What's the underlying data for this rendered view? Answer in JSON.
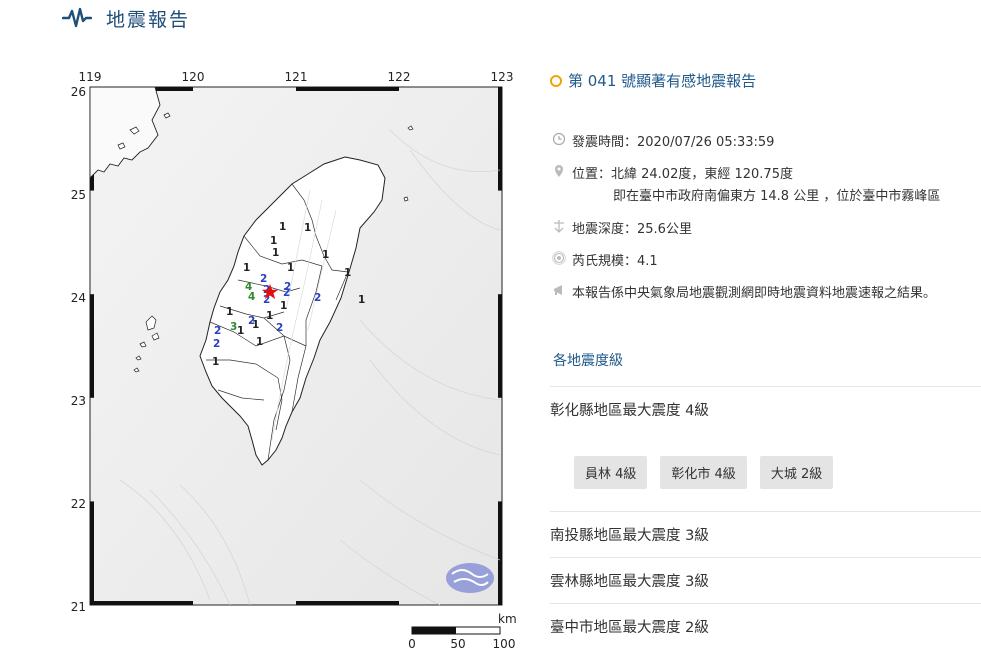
{
  "header": {
    "title": "地震報告",
    "icon": "seismograph-icon"
  },
  "report": {
    "title": "第 041 號顯著有感地震報告",
    "time_label": "發震時間：2020/07/26 05:33:59",
    "location_label": "位置：北緯 24.02度，東經 120.75度",
    "location_detail": "即在臺中市政府南偏東方 14.8 公里 ，位於臺中市霧峰區",
    "depth_label": "地震深度：25.6公里",
    "magnitude_label": "芮氏規模：4.1",
    "note": "本報告係中央氣象局地震觀測網即時地震資料地震速報之結果。"
  },
  "intensity": {
    "section_title": "各地震度級",
    "regions": [
      {
        "label": "彰化縣地區最大震度 4級",
        "chips": [
          "員林 4級",
          "彰化市 4級",
          "大城 2級"
        ]
      },
      {
        "label": "南投縣地區最大震度 3級"
      },
      {
        "label": "雲林縣地區最大震度 3級"
      },
      {
        "label": "臺中市地區最大震度 2級"
      }
    ]
  },
  "map": {
    "lon_ticks": [
      "119",
      "120",
      "121",
      "122",
      "123"
    ],
    "lat_ticks": [
      "26",
      "25",
      "24",
      "23",
      "22",
      "21"
    ],
    "scale_unit": "km",
    "scale_labels": [
      "0",
      "50",
      "100"
    ],
    "colors": {
      "level1": "#222222",
      "level2": "#2a3fc4",
      "level3": "#2e8b2e",
      "level4": "#2e8b2e",
      "epicenter": "#e01010"
    },
    "intensity_marks": [
      {
        "text": "1",
        "level": 1
      },
      {
        "text": "1",
        "level": 1
      },
      {
        "text": "1",
        "level": 1
      },
      {
        "text": "1",
        "level": 1
      },
      {
        "text": "1",
        "level": 1
      },
      {
        "text": "1",
        "level": 1
      },
      {
        "text": "1",
        "level": 1
      },
      {
        "text": "1",
        "level": 1
      },
      {
        "text": "1",
        "level": 1
      },
      {
        "text": "2",
        "level": 2
      },
      {
        "text": "2",
        "level": 2
      },
      {
        "text": "2",
        "level": 2
      },
      {
        "text": "2",
        "level": 2
      },
      {
        "text": "2",
        "level": 2
      },
      {
        "text": "2",
        "level": 2
      },
      {
        "text": "2",
        "level": 2
      },
      {
        "text": "2",
        "level": 2
      },
      {
        "text": "2",
        "level": 2
      },
      {
        "text": "4",
        "level": 4
      },
      {
        "text": "4",
        "level": 4
      },
      {
        "text": "3",
        "level": 3
      },
      {
        "text": "1",
        "level": 1
      },
      {
        "text": "1",
        "level": 1
      },
      {
        "text": "1",
        "level": 1
      },
      {
        "text": "1",
        "level": 1
      },
      {
        "text": "1",
        "level": 1
      },
      {
        "text": "1",
        "level": 1
      },
      {
        "text": "2",
        "level": 2
      },
      {
        "text": "1",
        "level": 1
      }
    ]
  }
}
